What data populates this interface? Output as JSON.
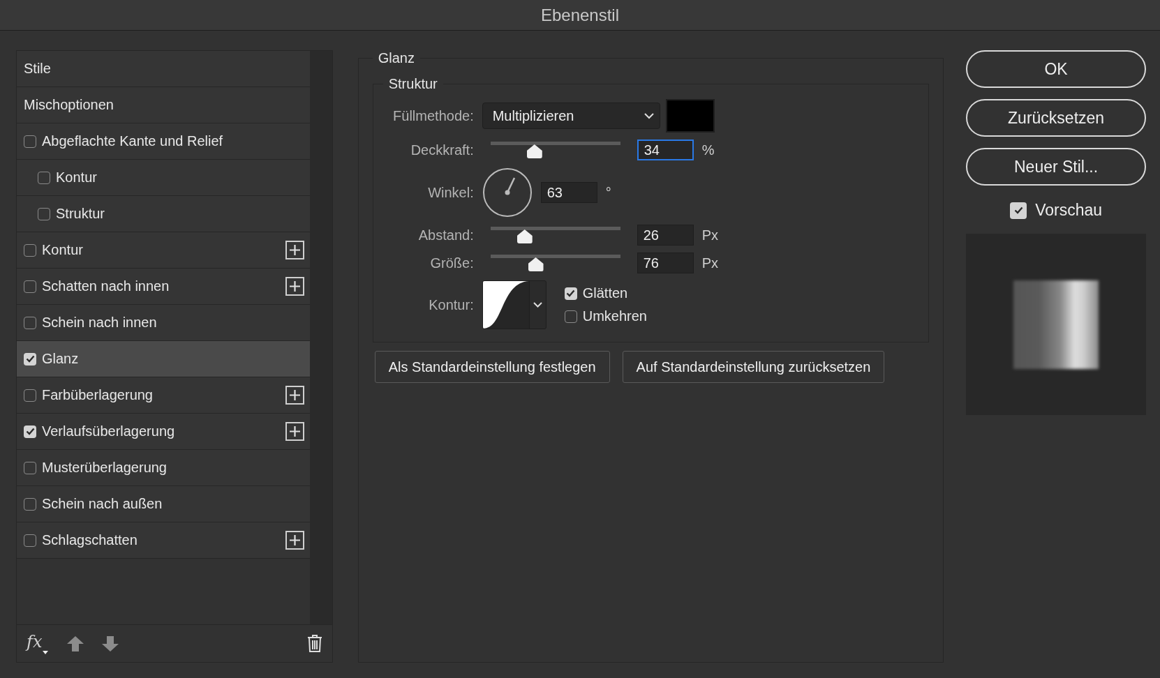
{
  "window": {
    "title": "Ebenenstil"
  },
  "styles": [
    {
      "kind": "header",
      "label": "Stile",
      "selected": false
    },
    {
      "kind": "header",
      "label": "Mischoptionen",
      "selected": false
    },
    {
      "kind": "effect",
      "label": "Abgeflachte Kante und Relief",
      "checked": false,
      "selected": false,
      "add_button": false,
      "children": [
        {
          "kind": "effect",
          "label": "Kontur",
          "checked": false,
          "selected": false,
          "add_button": false
        },
        {
          "kind": "effect",
          "label": "Struktur",
          "checked": false,
          "selected": false,
          "add_button": false
        }
      ]
    },
    {
      "kind": "effect",
      "label": "Kontur",
      "checked": false,
      "selected": false,
      "add_button": true
    },
    {
      "kind": "effect",
      "label": "Schatten nach innen",
      "checked": false,
      "selected": false,
      "add_button": true
    },
    {
      "kind": "effect",
      "label": "Schein nach innen",
      "checked": false,
      "selected": false,
      "add_button": false
    },
    {
      "kind": "effect",
      "label": "Glanz",
      "checked": true,
      "selected": true,
      "add_button": false
    },
    {
      "kind": "effect",
      "label": "Farbüberlagerung",
      "checked": false,
      "selected": false,
      "add_button": true
    },
    {
      "kind": "effect",
      "label": "Verlaufsüberlagerung",
      "checked": true,
      "selected": false,
      "add_button": true
    },
    {
      "kind": "effect",
      "label": "Musterüberlagerung",
      "checked": false,
      "selected": false,
      "add_button": false
    },
    {
      "kind": "effect",
      "label": "Schein nach außen",
      "checked": false,
      "selected": false,
      "add_button": false
    },
    {
      "kind": "effect",
      "label": "Schlagschatten",
      "checked": false,
      "selected": false,
      "add_button": true
    }
  ],
  "styles_toolbar": {
    "fx_label": "fx"
  },
  "panel": {
    "title": "Glanz",
    "group_title": "Struktur",
    "blend_mode": {
      "label": "Füllmethode:",
      "value": "Multiplizieren"
    },
    "opacity": {
      "label": "Deckkraft:",
      "level": 0.33,
      "value": "34",
      "unit": "%",
      "focused": true
    },
    "angle": {
      "label": "Winkel:",
      "value": "63",
      "unit": "°"
    },
    "distance": {
      "label": "Abstand:",
      "level": 0.25,
      "value": "26",
      "unit": "Px"
    },
    "size": {
      "label": "Größe:",
      "level": 0.34,
      "value": "76",
      "unit": "Px"
    },
    "contour": {
      "label": "Kontur:"
    },
    "options": [
      {
        "label": "Glätten",
        "checked": true
      },
      {
        "label": "Umkehren",
        "checked": false
      }
    ],
    "buttons": [
      "Als Standardeinstellung festlegen",
      "Auf Standardeinstellung zurücksetzen"
    ]
  },
  "actions": [
    "OK",
    "Zurücksetzen",
    "Neuer Stil..."
  ],
  "preview": {
    "label": "Vorschau",
    "checked": true
  }
}
